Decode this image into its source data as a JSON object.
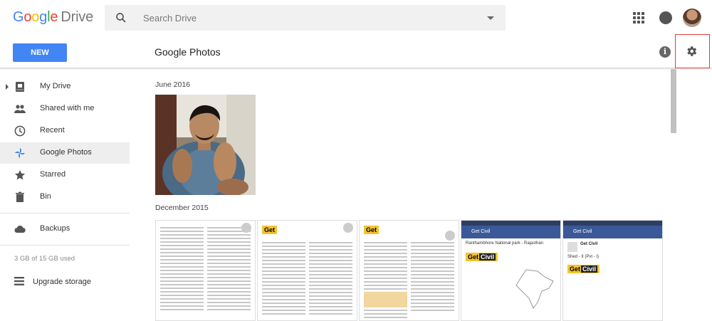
{
  "app": {
    "logo_google": "Google",
    "logo_product": "Drive"
  },
  "search": {
    "placeholder": "Search Drive"
  },
  "toolbar": {
    "new_label": "NEW",
    "page_title": "Google Photos"
  },
  "sidebar": {
    "items": [
      {
        "label": "My Drive",
        "icon": "my-drive-icon"
      },
      {
        "label": "Shared with me",
        "icon": "people-icon"
      },
      {
        "label": "Recent",
        "icon": "clock-icon"
      },
      {
        "label": "Google Photos",
        "icon": "photos-pinwheel-icon",
        "active": true
      },
      {
        "label": "Starred",
        "icon": "star-icon"
      },
      {
        "label": "Bin",
        "icon": "trash-icon"
      },
      {
        "label": "Backups",
        "icon": "cloud-icon"
      }
    ],
    "storage_text": "3 GB of 15 GB used",
    "upgrade_label": "Upgrade storage"
  },
  "main": {
    "sections": [
      {
        "title": "June 2016"
      },
      {
        "title": "December 2015"
      }
    ],
    "thumbs": {
      "brand_left": "Get",
      "brand_right": "Civil",
      "mob1_bar": "Get Civil",
      "mob1_heading": "Ranthambhore National park - Rajasthan",
      "mob2_bar": "Get Civil",
      "mob2_name": "Get Civil",
      "mob2_shed": "Shed - II (Pvt - I)"
    }
  },
  "colors": {
    "accent": "#4285f4",
    "highlight_box": "#e53935",
    "facebook_bar": "#3b5998"
  }
}
